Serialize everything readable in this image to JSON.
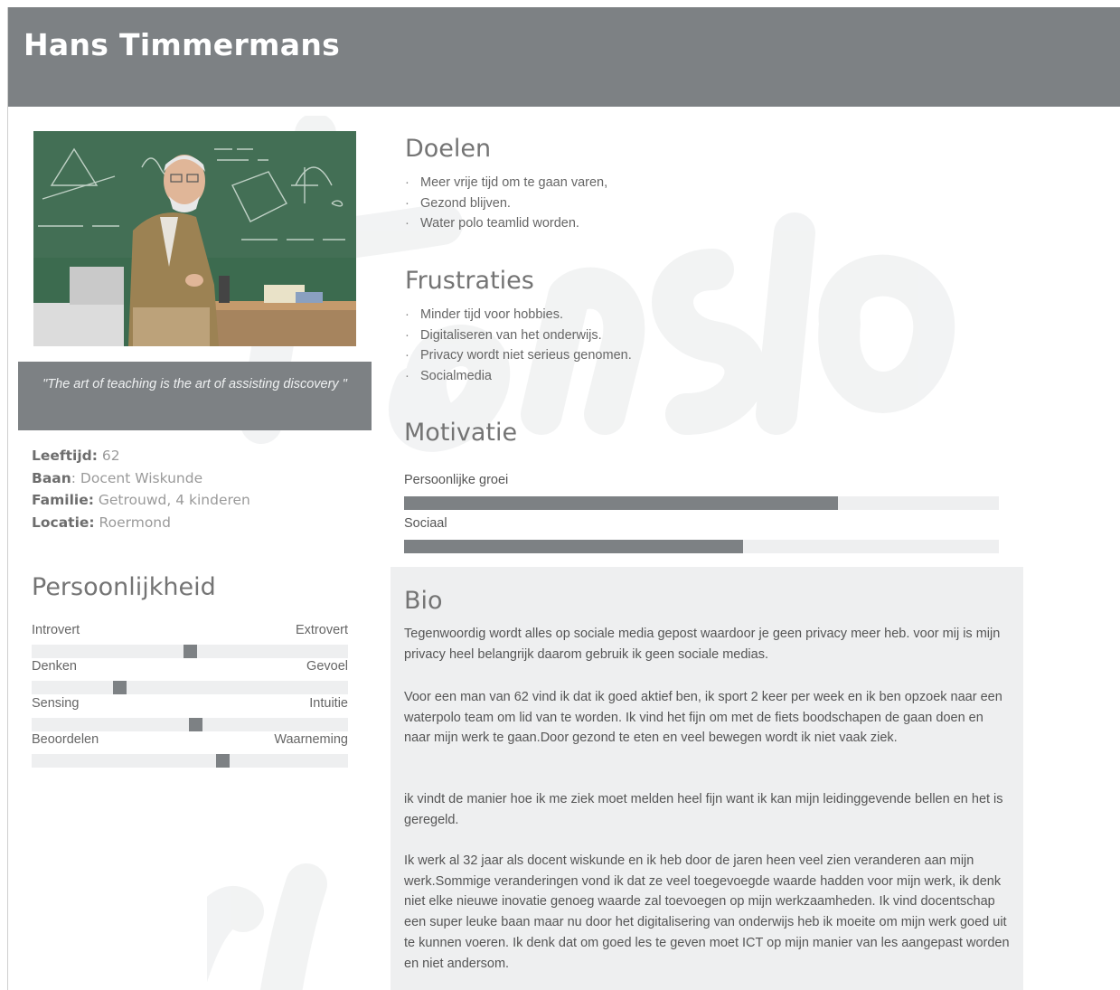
{
  "name": "Hans Timmermans",
  "quote": "\"The art of teaching is the art of assisting discovery \"",
  "facts": [
    {
      "label": "Leeftijd:",
      "value": " 62"
    },
    {
      "label": "Baan",
      "value": ": Docent Wiskunde"
    },
    {
      "label": "Familie:",
      "value": " Getrouwd, 4 kinderen"
    },
    {
      "label": "Locatie:",
      "value": " Roermond"
    }
  ],
  "personality": {
    "title": "Persoonlijkheid",
    "scales": [
      {
        "left": "Introvert",
        "right": "Extrovert",
        "level": 0.5
      },
      {
        "left": "Denken",
        "right": "Gevoel",
        "level": 0.27
      },
      {
        "left": "Sensing",
        "right": "Intuitie",
        "level": 0.52
      },
      {
        "left": "Beoordelen",
        "right": "Waarneming",
        "level": 0.61
      }
    ]
  },
  "goals": {
    "title": "Doelen",
    "items": [
      "Meer vrije tijd om te gaan varen,",
      "Gezond blijven.",
      "Water polo teamlid worden."
    ]
  },
  "frustrations": {
    "title": "Frustraties",
    "items": [
      "Minder tijd voor hobbies.",
      "Digitaliseren van het onderwijs.",
      "Privacy wordt niet serieus genomen.",
      "Socialmedia"
    ]
  },
  "motivation": {
    "title": "Motivatie",
    "bars": [
      {
        "label": "Persoonlijke groei",
        "level": 0.73
      },
      {
        "label": "Sociaal",
        "level": 0.57
      }
    ]
  },
  "bio": {
    "title": "Bio",
    "paragraphs": [
      "Tegenwoordig wordt alles op sociale media gepost waardoor je geen privacy meer heb. voor mij is mijn privacy heel belangrijk daarom gebruik ik geen sociale medias.",
      "Voor een  man van 62 vind ik dat ik goed aktief ben, ik sport 2 keer per week en ik ben opzoek naar een waterpolo team om lid van te worden. Ik vind het fijn om met de fiets boodschapen de gaan doen en naar mijn werk te gaan.Door gezond te eten en veel bewegen wordt ik niet vaak ziek.",
      "ik vindt de manier hoe ik  me ziek moet melden heel fijn want ik kan mijn leidinggevende bellen en het is geregeld.",
      "Ik werk al 32 jaar als docent wiskunde en ik heb door de jaren heen veel zien veranderen aan mijn werk.Sommige veranderingen vond ik dat ze veel toegevoegde waarde hadden voor mijn werk, ik denk niet elke nieuwe inovatie genoeg waarde zal toevoegen op mijn werkzaamheden. Ik vind docentschap een super leuke baan maar nu door het digitalisering van onderwijs heb ik moeite om mijn werk goed uit te kunnen voeren. Ik denk dat om goed les te geven moet ICT op mijn manier van les aangepast worden en niet andersom."
    ]
  },
  "colors": {
    "accent": "#7d8184",
    "track": "#eeeff0"
  }
}
